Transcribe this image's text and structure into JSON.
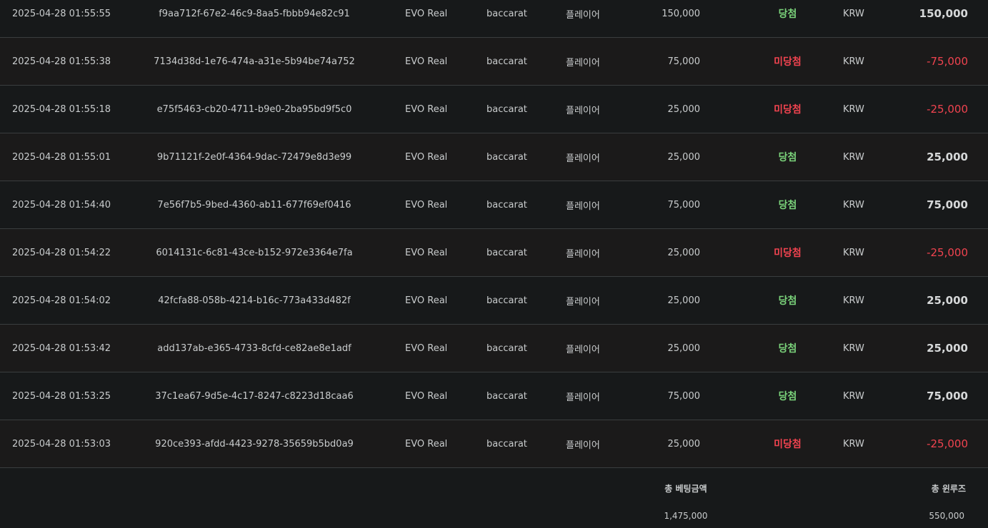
{
  "rows": [
    {
      "time": "2025-04-28 01:55:55",
      "id": "f9aa712f-67e2-46c9-8aa5-fbbb94e82c91",
      "provider": "EVO Real",
      "game": "baccarat",
      "bet_on": "플레이어",
      "amount": "150,000",
      "result": "당첨",
      "outcome": "win",
      "currency": "KRW",
      "winloss": "150,000"
    },
    {
      "time": "2025-04-28 01:55:38",
      "id": "7134d38d-1e76-474a-a31e-5b94be74a752",
      "provider": "EVO Real",
      "game": "baccarat",
      "bet_on": "플레이어",
      "amount": "75,000",
      "result": "미당첨",
      "outcome": "lose",
      "currency": "KRW",
      "winloss": "-75,000"
    },
    {
      "time": "2025-04-28 01:55:18",
      "id": "e75f5463-cb20-4711-b9e0-2ba95bd9f5c0",
      "provider": "EVO Real",
      "game": "baccarat",
      "bet_on": "플레이어",
      "amount": "25,000",
      "result": "미당첨",
      "outcome": "lose",
      "currency": "KRW",
      "winloss": "-25,000"
    },
    {
      "time": "2025-04-28 01:55:01",
      "id": "9b71121f-2e0f-4364-9dac-72479e8d3e99",
      "provider": "EVO Real",
      "game": "baccarat",
      "bet_on": "플레이어",
      "amount": "25,000",
      "result": "당첨",
      "outcome": "win",
      "currency": "KRW",
      "winloss": "25,000"
    },
    {
      "time": "2025-04-28 01:54:40",
      "id": "7e56f7b5-9bed-4360-ab11-677f69ef0416",
      "provider": "EVO Real",
      "game": "baccarat",
      "bet_on": "플레이어",
      "amount": "75,000",
      "result": "당첨",
      "outcome": "win",
      "currency": "KRW",
      "winloss": "75,000"
    },
    {
      "time": "2025-04-28 01:54:22",
      "id": "6014131c-6c81-43ce-b152-972e3364e7fa",
      "provider": "EVO Real",
      "game": "baccarat",
      "bet_on": "플레이어",
      "amount": "25,000",
      "result": "미당첨",
      "outcome": "lose",
      "currency": "KRW",
      "winloss": "-25,000"
    },
    {
      "time": "2025-04-28 01:54:02",
      "id": "42fcfa88-058b-4214-b16c-773a433d482f",
      "provider": "EVO Real",
      "game": "baccarat",
      "bet_on": "플레이어",
      "amount": "25,000",
      "result": "당첨",
      "outcome": "win",
      "currency": "KRW",
      "winloss": "25,000"
    },
    {
      "time": "2025-04-28 01:53:42",
      "id": "add137ab-e365-4733-8cfd-ce82ae8e1adf",
      "provider": "EVO Real",
      "game": "baccarat",
      "bet_on": "플레이어",
      "amount": "25,000",
      "result": "당첨",
      "outcome": "win",
      "currency": "KRW",
      "winloss": "25,000"
    },
    {
      "time": "2025-04-28 01:53:25",
      "id": "37c1ea67-9d5e-4c17-8247-c8223d18caa6",
      "provider": "EVO Real",
      "game": "baccarat",
      "bet_on": "플레이어",
      "amount": "75,000",
      "result": "당첨",
      "outcome": "win",
      "currency": "KRW",
      "winloss": "75,000"
    },
    {
      "time": "2025-04-28 01:53:03",
      "id": "920ce393-afdd-4423-9278-35659b5bd0a9",
      "provider": "EVO Real",
      "game": "baccarat",
      "bet_on": "플레이어",
      "amount": "25,000",
      "result": "미당첨",
      "outcome": "lose",
      "currency": "KRW",
      "winloss": "-25,000"
    }
  ],
  "footer": {
    "total_bet_label": "총 베팅금액",
    "total_bet_value": "1,475,000",
    "total_winloss_label": "총 윈루즈",
    "total_winloss_value": "550,000"
  },
  "colors": {
    "win": "#7ad27a",
    "lose": "#f0434f",
    "background": "#171a1b",
    "divider": "#3a3d3f"
  }
}
